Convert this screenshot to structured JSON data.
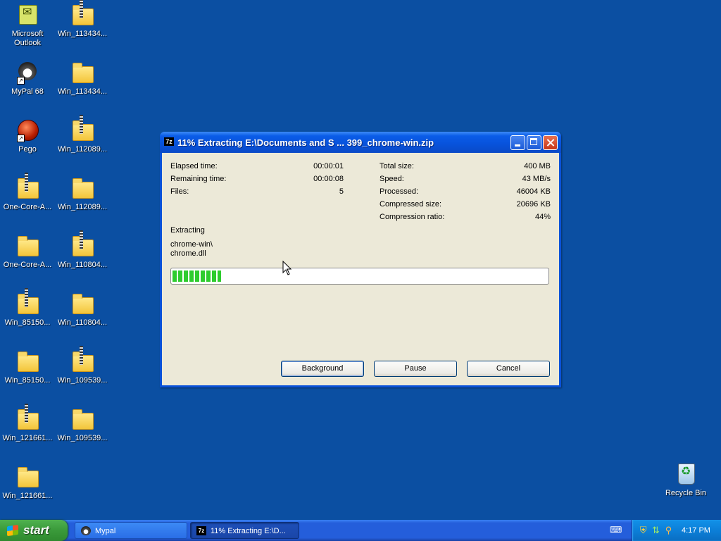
{
  "desktop": {
    "icons": [
      {
        "label": "Microsoft Outlook",
        "icon": "outlook-icon"
      },
      {
        "label": "Win_113434...",
        "icon": "zip-folder-icon"
      },
      {
        "label": "MyPal 68",
        "icon": "mypal-icon"
      },
      {
        "label": "Win_113434...",
        "icon": "folder-icon"
      },
      {
        "label": "Pego",
        "icon": "pego-icon"
      },
      {
        "label": "Win_112089...",
        "icon": "zip-folder-icon"
      },
      {
        "label": "One-Core-A...",
        "icon": "zip-folder-icon"
      },
      {
        "label": "Win_112089...",
        "icon": "folder-icon"
      },
      {
        "label": "One-Core-A...",
        "icon": "folder-icon"
      },
      {
        "label": "Win_110804...",
        "icon": "zip-folder-icon"
      },
      {
        "label": "Win_85150...",
        "icon": "zip-folder-icon"
      },
      {
        "label": "Win_110804...",
        "icon": "folder-icon"
      },
      {
        "label": "Win_85150...",
        "icon": "folder-icon"
      },
      {
        "label": "Win_109539...",
        "icon": "zip-folder-icon"
      },
      {
        "label": "Win_121661...",
        "icon": "zip-folder-icon"
      },
      {
        "label": "Win_109539...",
        "icon": "folder-icon"
      },
      {
        "label": "Win_121661...",
        "icon": "folder-icon"
      },
      {
        "label": "Recycle Bin",
        "icon": "recycle-bin-icon"
      }
    ]
  },
  "window": {
    "app_icon_text": "7z",
    "title": "11% Extracting E:\\Documents and S ... 399_chrome-win.zip",
    "stats_left": [
      {
        "label": "Elapsed time:",
        "value": "00:00:01"
      },
      {
        "label": "Remaining time:",
        "value": "00:00:08"
      },
      {
        "label": "Files:",
        "value": "5"
      }
    ],
    "stats_right": [
      {
        "label": "Total size:",
        "value": "400 MB"
      },
      {
        "label": "Speed:",
        "value": "43 MB/s"
      },
      {
        "label": "Processed:",
        "value": "46004 KB"
      },
      {
        "label": "Compressed size:",
        "value": "20696 KB"
      },
      {
        "label": "Compression ratio:",
        "value": "44%"
      }
    ],
    "operation": "Extracting",
    "current_path": "chrome-win\\",
    "current_file": "chrome.dll",
    "progress_fraction": 0.13,
    "buttons": {
      "background": "Background",
      "pause": "Pause",
      "cancel": "Cancel"
    }
  },
  "taskbar": {
    "start_label": "start",
    "tasks": [
      {
        "label": "Mypal",
        "icon": "mypal-icon"
      },
      {
        "label": "11% Extracting E:\\D...",
        "icon": "7zip-icon"
      }
    ],
    "clock": "4:17 PM"
  },
  "colors": {
    "desktop": "#0b4fa2",
    "titlebar": "#0a52d9",
    "progress": "#2ecc2e",
    "start_button": "#3a9a3a"
  }
}
